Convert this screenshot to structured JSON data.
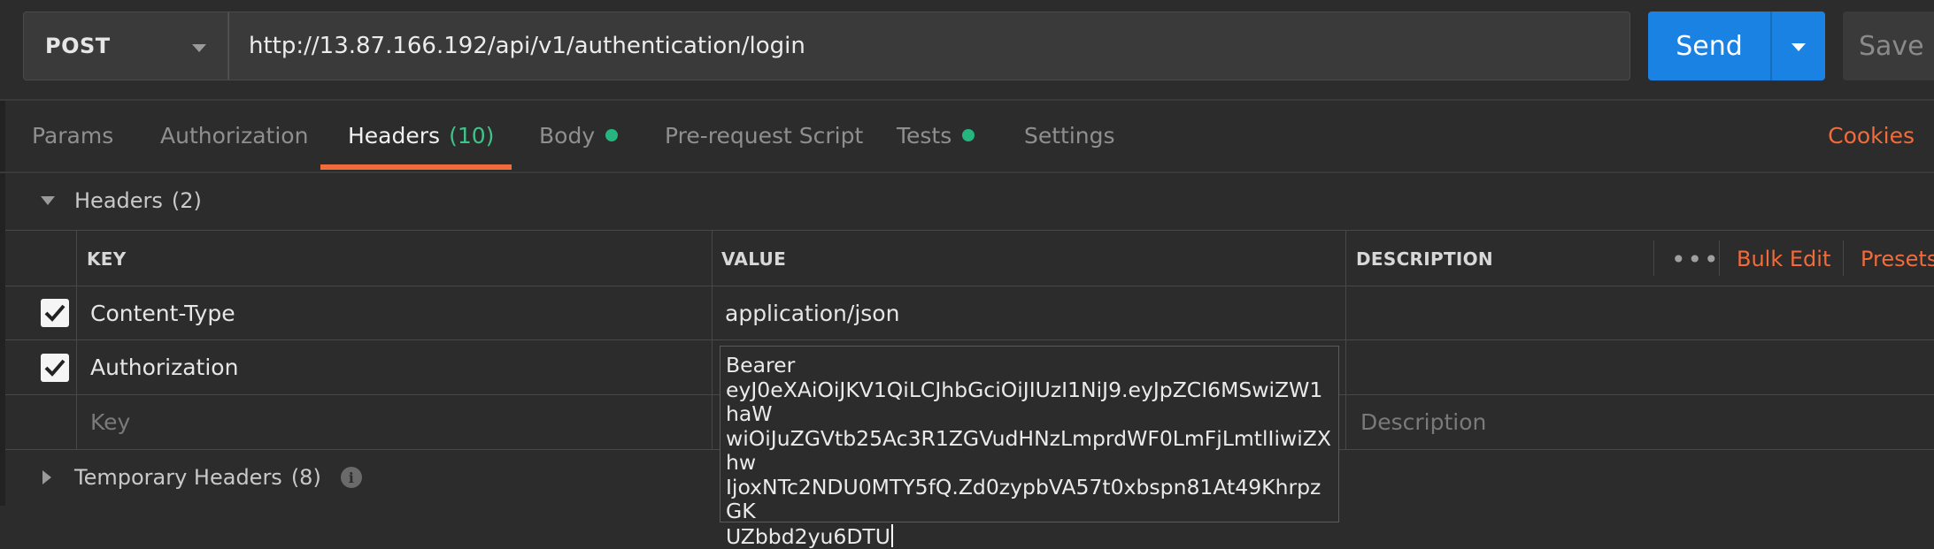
{
  "request": {
    "method": "POST",
    "url": "http://13.87.166.192/api/v1/authentication/login",
    "send_label": "Send",
    "save_label": "Save"
  },
  "tabs": [
    {
      "label": "Params"
    },
    {
      "label": "Authorization"
    },
    {
      "label": "Headers",
      "count": "(10)",
      "active": true
    },
    {
      "label": "Body",
      "dot": true
    },
    {
      "label": "Pre-request Script"
    },
    {
      "label": "Tests",
      "dot": true
    },
    {
      "label": "Settings"
    }
  ],
  "cookies_label": "Cookies",
  "headers_section": {
    "title": "Headers",
    "count": "(2)",
    "columns": {
      "key": "KEY",
      "value": "VALUE",
      "description": "DESCRIPTION"
    },
    "menu_icon": "more-dots-icon",
    "bulk_edit_label": "Bulk Edit",
    "presets_label": "Presets",
    "rows": [
      {
        "checked": true,
        "key": "Content-Type",
        "value": "application/json",
        "description": ""
      },
      {
        "checked": true,
        "key": "Authorization",
        "value": "Bearer eyJ0eXAiOiJKV1QiLCJhbGciOiJIUzI1NiJ9.eyJpZCI6MSwiZW1haWwiOiJuZGVtb25Ac3R1ZGVudHNzLmprdWF0LmFjLmtlIiwiZXhwIjoxNTc2NDU0MTY5fQ.Zd0zypbVA57t0xbspn81At49KhrpzGKUZbbd2yu6DTU",
        "description": ""
      }
    ],
    "placeholder": {
      "key": "Key",
      "description": "Description"
    }
  },
  "editing_value": {
    "line1": "Bearer",
    "line2": "eyJ0eXAiOiJKV1QiLCJhbGciOiJIUzI1NiJ9.eyJpZCI6MSwiZW1haW",
    "line3": "wiOiJuZGVtb25Ac3R1ZGVudHNzLmprdWF0LmFjLmtlIiwiZXhw",
    "line4": "IjoxNTc2NDU0MTY5fQ.Zd0zypbVA57t0xbspn81At49KhrpzGK",
    "line5": "UZbbd2yu6DTU"
  },
  "temporary_headers": {
    "title": "Temporary Headers",
    "count": "(8)",
    "icon": "info-icon"
  },
  "colors": {
    "accent_orange": "#f26b3a",
    "send_blue": "#1a82e2",
    "status_green": "#26b47f"
  }
}
